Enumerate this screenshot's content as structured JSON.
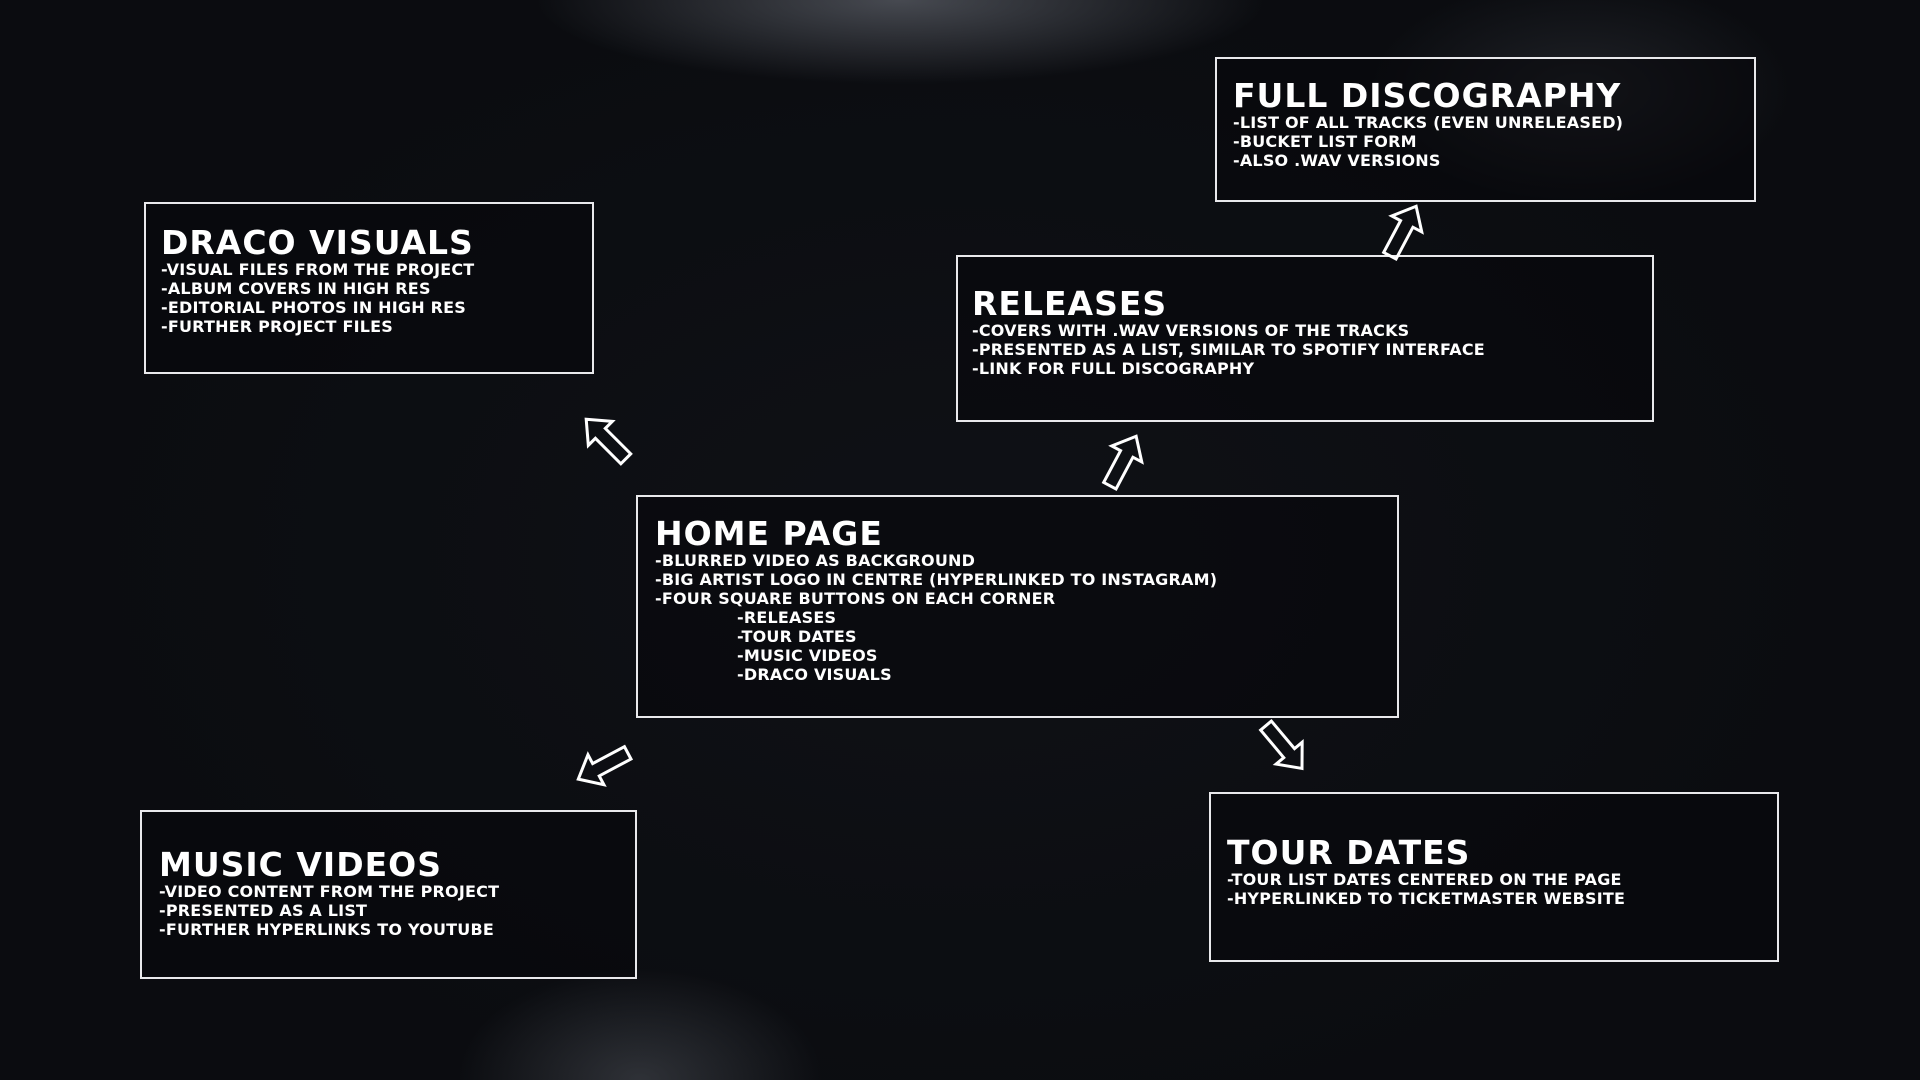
{
  "nodes": {
    "full_discography": {
      "title": "FULL DISCOGRAPHY",
      "lines": [
        "-LIST OF ALL TRACKS (EVEN UNRELEASED)",
        "-BUCKET LIST FORM",
        "-ALSO .WAV VERSIONS"
      ]
    },
    "draco_visuals": {
      "title": "DRACO VISUALS",
      "lines": [
        "-VISUAL FILES FROM THE PROJECT",
        "-ALBUM COVERS IN HIGH RES",
        "-EDITORIAL PHOTOS IN HIGH RES",
        "-FURTHER PROJECT FILES"
      ]
    },
    "releases": {
      "title": "RELEASES",
      "lines": [
        "-COVERS WITH .WAV VERSIONS OF THE TRACKS",
        "-PRESENTED AS A LIST, SIMILAR TO SPOTIFY INTERFACE",
        "-LINK FOR FULL DISCOGRAPHY"
      ]
    },
    "home_page": {
      "title": "HOME PAGE",
      "lines": [
        "-BLURRED VIDEO AS BACKGROUND",
        "-BIG ARTIST LOGO IN CENTRE (HYPERLINKED TO INSTAGRAM)",
        "-FOUR SQUARE BUTTONS ON EACH CORNER"
      ],
      "sublines": [
        "-RELEASES",
        "-TOUR DATES",
        "-MUSIC VIDEOS",
        "-DRACO VISUALS"
      ]
    },
    "music_videos": {
      "title": "MUSIC VIDEOS",
      "lines": [
        "-VIDEO CONTENT FROM THE PROJECT",
        "-PRESENTED AS A LIST",
        "-FURTHER HYPERLINKS TO YOUTUBE"
      ]
    },
    "tour_dates": {
      "title": "TOUR DATES",
      "lines": [
        "-TOUR LIST DATES CENTERED ON THE PAGE",
        "-HYPERLINKED TO TICKETMASTER WEBSITE"
      ]
    }
  },
  "connectors": [
    {
      "from": "home_page",
      "to": "draco_visuals",
      "icon": "outline-arrow-icon"
    },
    {
      "from": "home_page",
      "to": "releases",
      "icon": "outline-arrow-icon"
    },
    {
      "from": "releases",
      "to": "full_discography",
      "icon": "outline-arrow-icon"
    },
    {
      "from": "home_page",
      "to": "music_videos",
      "icon": "outline-arrow-icon"
    },
    {
      "from": "home_page",
      "to": "tour_dates",
      "icon": "outline-arrow-icon"
    }
  ],
  "colors": {
    "background": "#0f1116",
    "stroke": "#e9e9ec",
    "text": "#ffffff"
  }
}
